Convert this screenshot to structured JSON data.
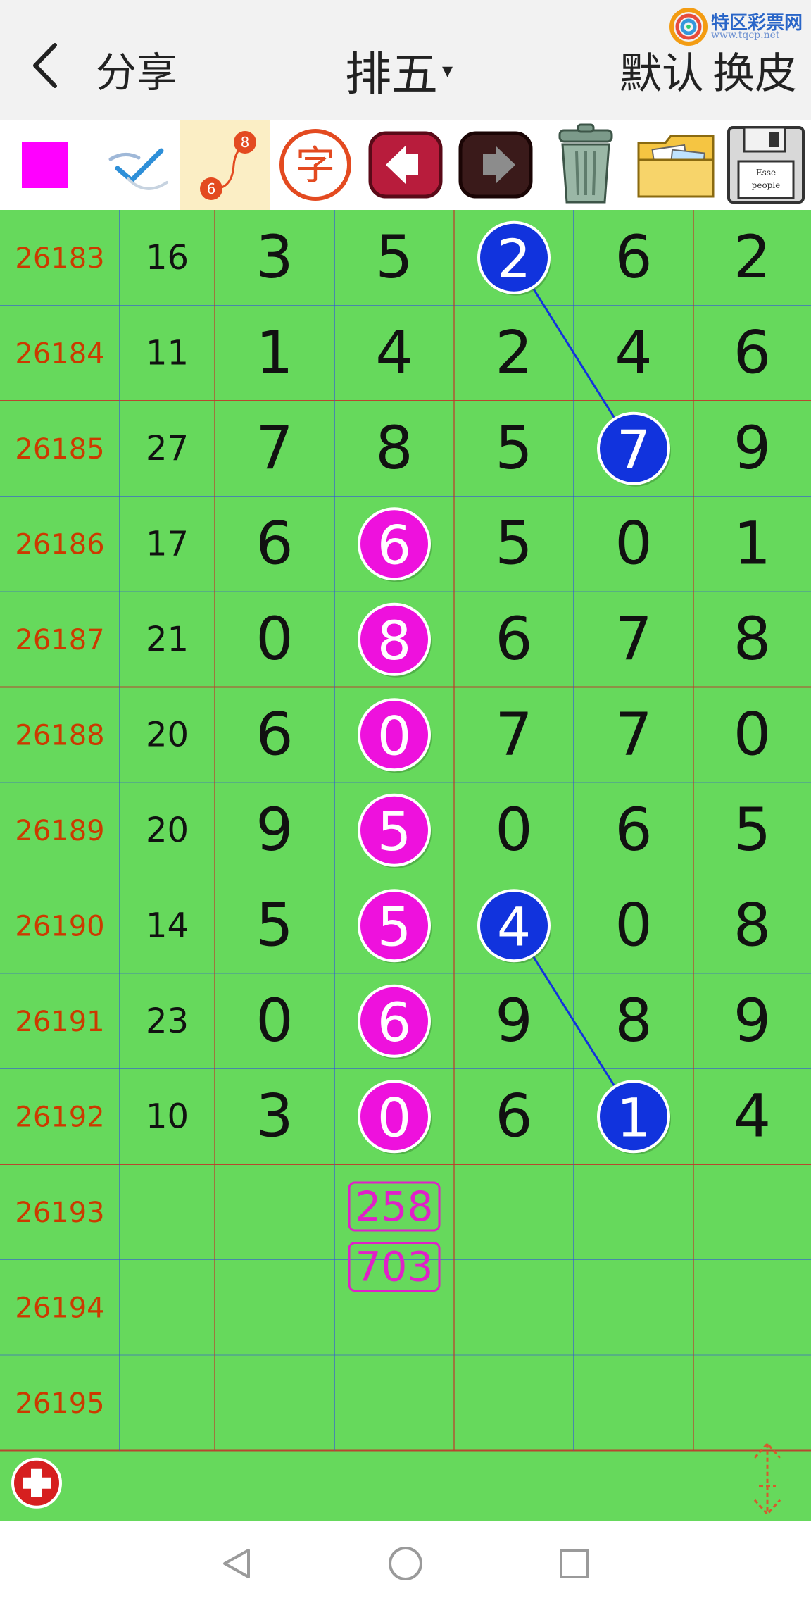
{
  "header": {
    "share_label": "分享",
    "title": "排五",
    "title_caret": "▾",
    "default_label": "默认",
    "skin_label": "换皮",
    "brand": {
      "name": "特区彩票网",
      "url": "www.tqcp.net"
    }
  },
  "toolbar": {
    "tools": [
      {
        "icon": "magenta-color-swatch-icon",
        "color": "#ff00ff"
      },
      {
        "icon": "pen-check-icon"
      },
      {
        "icon": "connect-line-icon",
        "badge_top": "8",
        "badge_bottom": "6",
        "selected": true
      },
      {
        "icon": "text-zi-icon",
        "text": "字"
      },
      {
        "icon": "undo-arrow-icon"
      },
      {
        "icon": "redo-arrow-icon"
      },
      {
        "icon": "trash-can-icon"
      },
      {
        "icon": "photo-folder-icon"
      },
      {
        "icon": "floppy-save-icon",
        "text_1": "Esse",
        "text_2": "people"
      }
    ]
  },
  "table": {
    "rows": [
      {
        "issue": "26183",
        "sum": "16",
        "digits": [
          "3",
          "5",
          "2",
          "6",
          "2"
        ]
      },
      {
        "issue": "26184",
        "sum": "11",
        "digits": [
          "1",
          "4",
          "2",
          "4",
          "6"
        ]
      },
      {
        "issue": "26185",
        "sum": "27",
        "digits": [
          "7",
          "8",
          "5",
          "7",
          "9"
        ]
      },
      {
        "issue": "26186",
        "sum": "17",
        "digits": [
          "6",
          "6",
          "5",
          "0",
          "1"
        ]
      },
      {
        "issue": "26187",
        "sum": "21",
        "digits": [
          "0",
          "8",
          "6",
          "7",
          "8"
        ]
      },
      {
        "issue": "26188",
        "sum": "20",
        "digits": [
          "6",
          "0",
          "7",
          "7",
          "0"
        ]
      },
      {
        "issue": "26189",
        "sum": "20",
        "digits": [
          "9",
          "5",
          "0",
          "6",
          "5"
        ]
      },
      {
        "issue": "26190",
        "sum": "14",
        "digits": [
          "5",
          "5",
          "4",
          "0",
          "8"
        ]
      },
      {
        "issue": "26191",
        "sum": "23",
        "digits": [
          "0",
          "6",
          "9",
          "8",
          "9"
        ]
      },
      {
        "issue": "26192",
        "sum": "10",
        "digits": [
          "3",
          "0",
          "6",
          "1",
          "4"
        ]
      },
      {
        "issue": "26193",
        "sum": "",
        "digits": [
          "",
          "",
          "",
          "",
          ""
        ]
      },
      {
        "issue": "26194",
        "sum": "",
        "digits": [
          "",
          "",
          "",
          "",
          ""
        ]
      },
      {
        "issue": "26195",
        "sum": "",
        "digits": [
          "",
          "",
          "",
          "",
          ""
        ]
      }
    ],
    "circles": [
      {
        "row": 0,
        "col": 2,
        "color": "#1133dd"
      },
      {
        "row": 2,
        "col": 3,
        "color": "#1133dd"
      },
      {
        "row": 3,
        "col": 1,
        "color": "#ee11dd"
      },
      {
        "row": 4,
        "col": 1,
        "color": "#ee11dd"
      },
      {
        "row": 5,
        "col": 1,
        "color": "#ee11dd"
      },
      {
        "row": 6,
        "col": 1,
        "color": "#ee11dd"
      },
      {
        "row": 7,
        "col": 1,
        "color": "#ee11dd"
      },
      {
        "row": 8,
        "col": 1,
        "color": "#ee11dd"
      },
      {
        "row": 9,
        "col": 1,
        "color": "#ee11dd"
      },
      {
        "row": 7,
        "col": 2,
        "color": "#1133dd"
      },
      {
        "row": 9,
        "col": 3,
        "color": "#1133dd"
      }
    ],
    "lines": [
      {
        "from": [
          0,
          2
        ],
        "to": [
          2,
          3
        ],
        "color": "#1133dd"
      },
      {
        "from": [
          7,
          2
        ],
        "to": [
          9,
          3
        ],
        "color": "#1133dd"
      }
    ],
    "predictions": [
      {
        "row": 10,
        "col": 1,
        "text": "258"
      },
      {
        "row": 11,
        "col": 1,
        "text": "703"
      }
    ],
    "colors": {
      "background": "#66d95c",
      "issue_text": "#cc3a00",
      "digit_text": "#111111",
      "red_line": "#c0392b",
      "blue_line": "#3355dd",
      "prediction": "#e020c8"
    }
  },
  "footer": {
    "add_icon": "plus-circle-icon",
    "scroll_icon": "expand-arrows-icon"
  },
  "navbar": {
    "icons": [
      "nav-back-icon",
      "nav-home-icon",
      "nav-recent-icon"
    ]
  }
}
